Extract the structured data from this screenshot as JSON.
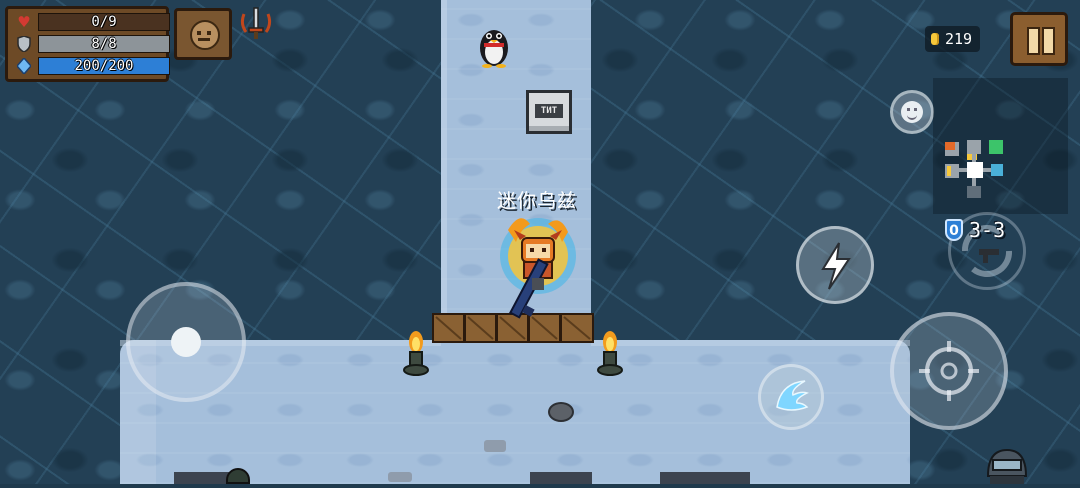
{
  "hud": {
    "health": {
      "text": "0/9",
      "fraction": 0.0,
      "color": "#c83a2e",
      "icon": "heart-icon"
    },
    "armor": {
      "text": "8/8",
      "fraction": 1.0,
      "color": "#8d9499",
      "icon": "shield-icon"
    },
    "energy": {
      "text": "200/200",
      "fraction": 1.0,
      "color": "#2d7fd6",
      "icon": "diamond-icon"
    },
    "coins": "219",
    "level": "3-3",
    "level_badge": "0"
  },
  "scene": {
    "player_name": "迷你乌兹",
    "crate_label": "TNT"
  },
  "colors": {
    "floor": "#a5bfdb",
    "wall": "#234055",
    "hud_wood": "#6d4a26",
    "gold": "#f6c83b",
    "energy_blue": "#2d7fd6"
  }
}
